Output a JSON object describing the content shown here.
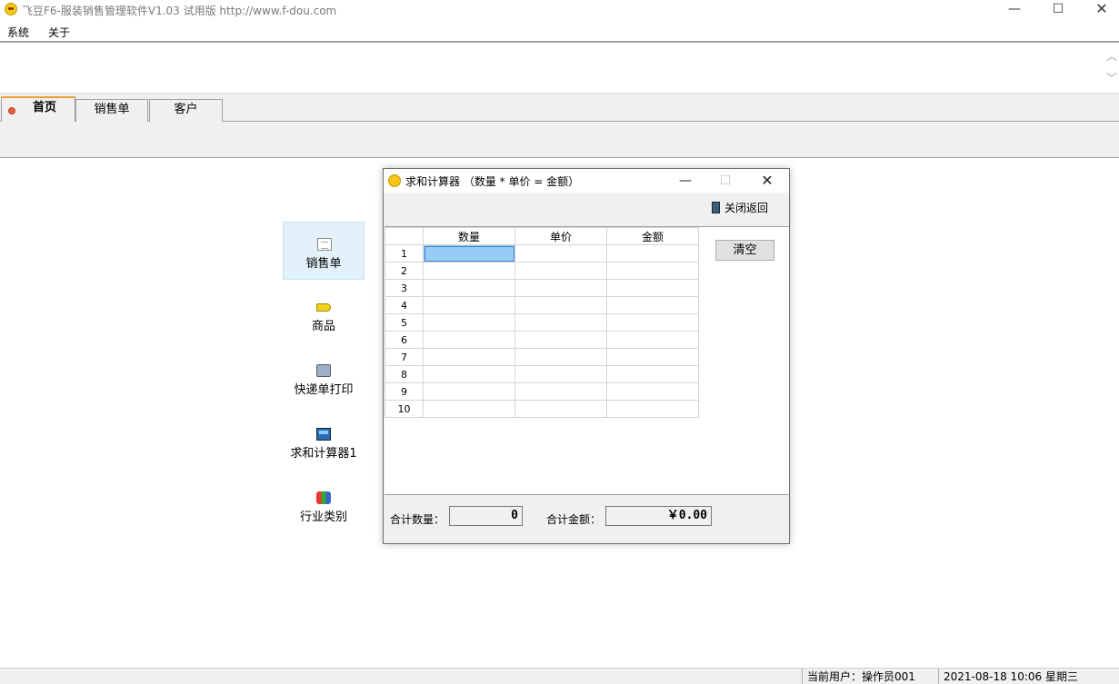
{
  "window": {
    "title": "飞豆F6-服装销售管理软件V1.03 试用版 http://www.f-dou.com",
    "min_glyph": "—",
    "max_glyph": "☐",
    "close_glyph": "✕"
  },
  "menu": [
    "系统",
    "关于"
  ],
  "toolbar_scroll": {
    "up": "︿",
    "down": "﹀"
  },
  "tabs": [
    {
      "label": "首页",
      "active": true
    },
    {
      "label": "销售单",
      "active": false
    },
    {
      "label": "客户",
      "active": false
    }
  ],
  "launcher": [
    {
      "label": "销售单",
      "icon": "document-icon",
      "selected": true
    },
    {
      "label": "商品",
      "icon": "tag-icon",
      "selected": false
    },
    {
      "label": "快递单打印",
      "icon": "printer-icon",
      "selected": false
    },
    {
      "label": "求和计算器1",
      "icon": "calculator-icon",
      "selected": false
    },
    {
      "label": "行业类别",
      "icon": "blocks-icon",
      "selected": false
    }
  ],
  "dialog": {
    "title": "求和计算器 （数量 * 单价 = 金额）",
    "min_glyph": "—",
    "max_glyph": "☐",
    "close_glyph": "✕",
    "close_back_label": "关闭返回",
    "clear_button": "清空",
    "columns": [
      "数量",
      "单价",
      "金额"
    ],
    "rows": [
      "1",
      "2",
      "3",
      "4",
      "5",
      "6",
      "7",
      "8",
      "9",
      "10"
    ],
    "total_qty_label": "合计数量：",
    "total_qty_value": "0",
    "total_amount_label": "合计金额：",
    "total_amount_value": "￥0.00"
  },
  "status": {
    "user": "当前用户：操作员001",
    "datetime": "2021-08-18 10:06 星期三"
  },
  "colors": {
    "selected_cell": "#99ccf5",
    "active_tab_accent": "#f0a030",
    "launcher_selected_bg": "#e3f1fb"
  }
}
